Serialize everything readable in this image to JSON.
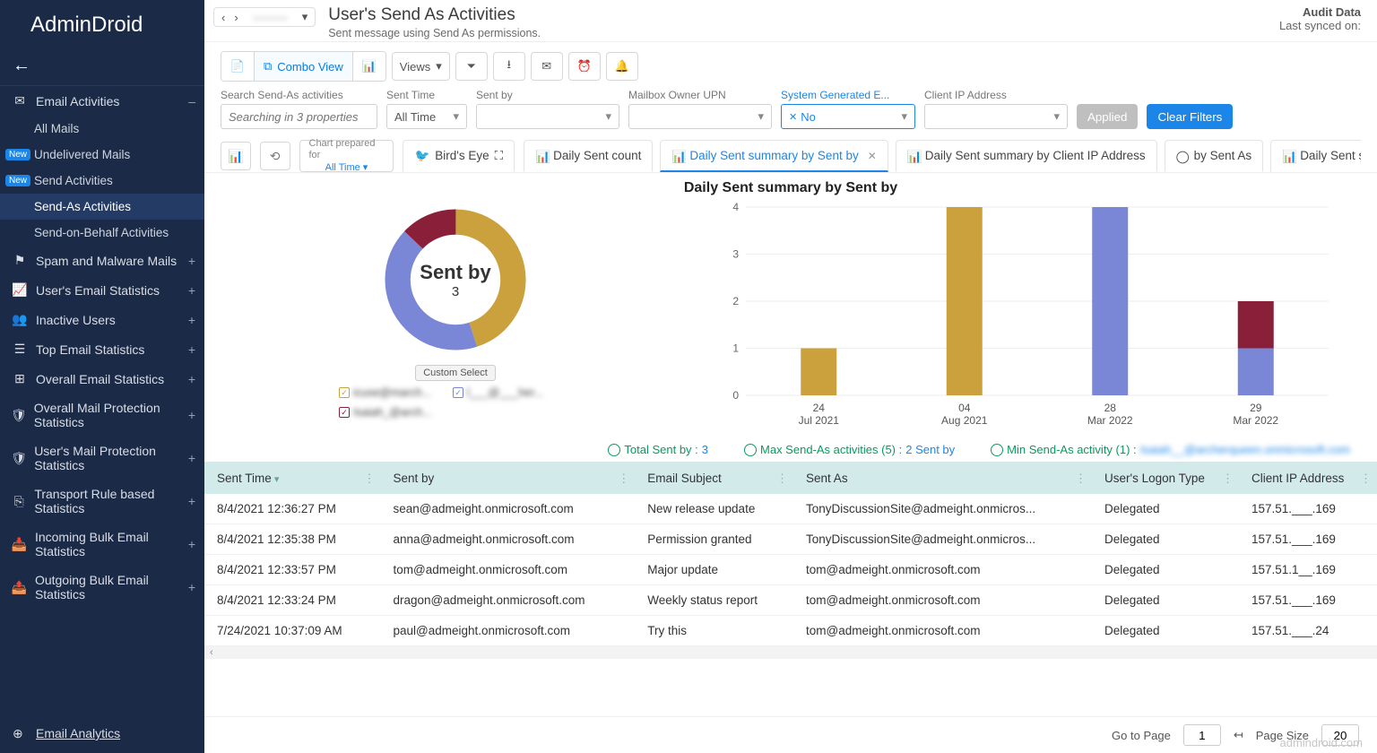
{
  "app": {
    "name": "AdminDroid"
  },
  "header": {
    "title": "User's Send As Activities",
    "subtitle": "Sent message using Send As permissions.",
    "scope_text": "———",
    "audit_label": "Audit Data",
    "synced_label": "Last synced on:"
  },
  "sidebar": {
    "section_main": "Email Activities",
    "items": [
      {
        "label": "All Mails",
        "new": false
      },
      {
        "label": "Undelivered Mails",
        "new": true
      },
      {
        "label": "Send Activities",
        "new": true
      },
      {
        "label": "Send-As Activities",
        "selected": true
      },
      {
        "label": "Send-on-Behalf Activities"
      }
    ],
    "sections": [
      "Spam and Malware Mails",
      "User's Email Statistics",
      "Inactive Users",
      "Top Email Statistics",
      "Overall Email Statistics",
      "Overall Mail Protection Statistics",
      "User's Mail Protection Statistics",
      "Transport Rule based Statistics",
      "Incoming Bulk Email Statistics",
      "Outgoing Bulk Email Statistics"
    ],
    "analytics": "Email Analytics"
  },
  "toolbar": {
    "combo": "Combo View",
    "views": "Views"
  },
  "filters": {
    "search_label": "Search Send-As activities",
    "search_placeholder": "Searching in 3 properties",
    "sent_time_label": "Sent Time",
    "sent_time_value": "All Time",
    "sent_by_label": "Sent by",
    "owner_label": "Mailbox Owner UPN",
    "sys_label": "System Generated E...",
    "sys_value": "No",
    "cip_label": "Client IP Address",
    "applied": "Applied",
    "clear": "Clear Filters"
  },
  "chart_tabs": {
    "meta_label": "Chart prepared for",
    "meta_value": "All Time",
    "birdseye": "Bird's Eye",
    "tabs": [
      "Daily Sent count",
      "Daily Sent summary by Sent by",
      "Daily Sent summary by Client IP Address",
      "by Sent As",
      "Daily Sent summary"
    ],
    "active_index": 1
  },
  "chart_title": "Daily Sent summary by Sent by",
  "chart_data": [
    {
      "type": "pie",
      "title": "Sent by",
      "center_value": "3",
      "series": [
        {
          "name": "sender-1",
          "value": 45,
          "color": "#caa13c"
        },
        {
          "name": "sender-2",
          "value": 42,
          "color": "#7a86d6"
        },
        {
          "name": "sender-3",
          "value": 13,
          "color": "#8a1f3a"
        }
      ],
      "legend_button": "Custom Select"
    },
    {
      "type": "bar",
      "stacked": true,
      "ylim": [
        0,
        4
      ],
      "yticks": [
        0,
        1,
        2,
        3,
        4
      ],
      "categories": [
        "24 Jul 2021",
        "04 Aug 2021",
        "28 Mar 2022",
        "29 Mar 2022"
      ],
      "series": [
        {
          "name": "sender-1",
          "color": "#caa13c",
          "values": [
            1,
            4,
            0,
            0
          ]
        },
        {
          "name": "sender-2",
          "color": "#7a86d6",
          "values": [
            0,
            0,
            4,
            1
          ]
        },
        {
          "name": "sender-3",
          "color": "#8a1f3a",
          "values": [
            0,
            0,
            0,
            1
          ]
        }
      ]
    }
  ],
  "summary": {
    "total_label": "Total Sent by :",
    "total_value": "3",
    "max_label": "Max Send-As activities (5) :",
    "max_value": "2 Sent by",
    "min_label": "Min Send-As activity (1) :",
    "min_value": "Isaiah__@archerqueen.onmicrosoft.com"
  },
  "table": {
    "columns": [
      "Sent Time",
      "Sent by",
      "Email Subject",
      "Sent As",
      "User's Logon Type",
      "Client IP Address"
    ],
    "rows": [
      [
        "8/4/2021 12:36:27 PM",
        "sean@admeight.onmicrosoft.com",
        "New release update",
        "TonyDiscussionSite@admeight.onmicros...",
        "Delegated",
        "157.51.___.169"
      ],
      [
        "8/4/2021 12:35:38 PM",
        "anna@admeight.onmicrosoft.com",
        "Permission granted",
        "TonyDiscussionSite@admeight.onmicros...",
        "Delegated",
        "157.51.___.169"
      ],
      [
        "8/4/2021 12:33:57 PM",
        "tom@admeight.onmicrosoft.com",
        "Major update",
        "tom@admeight.onmicrosoft.com",
        "Delegated",
        "157.51.1__.169"
      ],
      [
        "8/4/2021 12:33:24 PM",
        "dragon@admeight.onmicrosoft.com",
        "Weekly status report",
        "tom@admeight.onmicrosoft.com",
        "Delegated",
        "157.51.___.169"
      ],
      [
        "7/24/2021 10:37:09 AM",
        "paul@admeight.onmicrosoft.com",
        "Try this",
        "tom@admeight.onmicrosoft.com",
        "Delegated",
        "157.51.___.24"
      ]
    ]
  },
  "footer": {
    "goto": "Go to Page",
    "page": "1",
    "pagesize_label": "Page Size",
    "pagesize": "20"
  },
  "watermark": "admindroid.com"
}
